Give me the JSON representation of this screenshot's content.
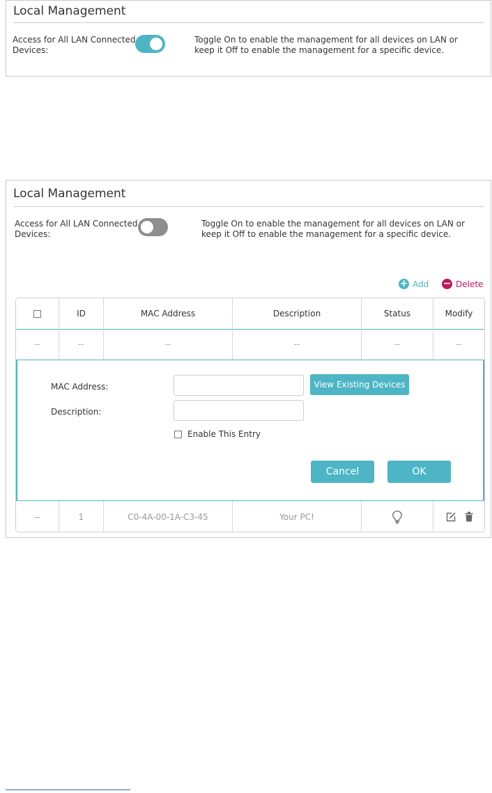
{
  "panel1": {
    "title": "Local Management",
    "access_label": "Access for All LAN Connected Devices:",
    "toggle_state": "on",
    "description": "Toggle On to enable the management for all devices on LAN or keep it Off to enable the management for a specific device."
  },
  "panel2": {
    "title": "Local Management",
    "access_label": "Access for All LAN Connected Devices:",
    "toggle_state": "off",
    "description": "Toggle On to enable the management for all devices on LAN or keep it Off to enable the management for a specific device.",
    "actions": {
      "add": "Add",
      "delete": "Delete"
    },
    "table": {
      "headers": [
        "ID",
        "MAC Address",
        "Description",
        "Status",
        "Modify"
      ],
      "empty_row": [
        "--",
        "--",
        "--",
        "--",
        "--",
        "--"
      ],
      "data_row": {
        "select": "--",
        "id": "1",
        "mac": "C0-4A-00-1A-C3-45",
        "description": "Your PC!"
      }
    },
    "form": {
      "mac_label": "MAC Address:",
      "mac_value": "",
      "description_label": "Description:",
      "description_value": "",
      "view_devices": "View Existing Devices",
      "enable_entry": "Enable This Entry",
      "cancel": "Cancel",
      "ok": "OK"
    }
  },
  "colors": {
    "accent": "#4db5c5",
    "delete": "#c2185b",
    "toggle_off": "#8e8e8e"
  }
}
